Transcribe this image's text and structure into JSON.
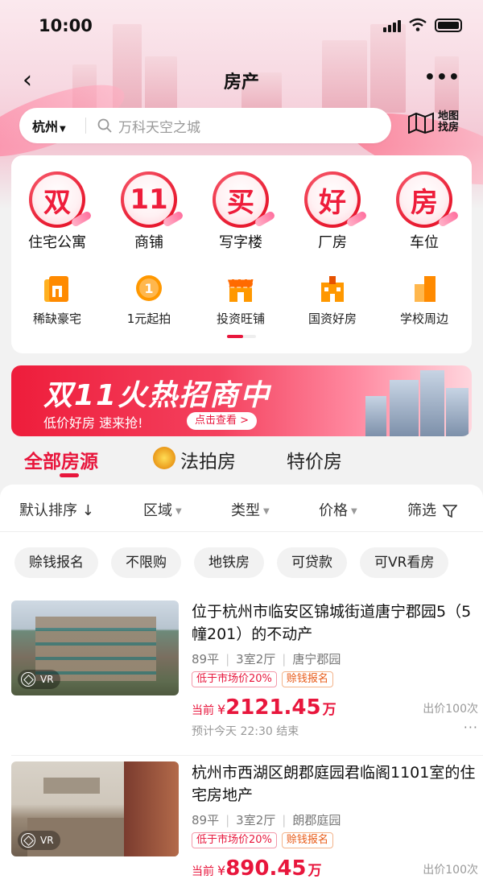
{
  "status": {
    "time": "10:00"
  },
  "nav": {
    "back": "‹",
    "title": "房产",
    "more": "•••"
  },
  "search": {
    "city": "杭州",
    "placeholder": "万科天空之城",
    "map_label": "地图找房"
  },
  "big_categories": [
    {
      "glyph": "双",
      "label": "住宅公寓"
    },
    {
      "glyph": "11",
      "label": "商铺"
    },
    {
      "glyph": "买",
      "label": "写字楼"
    },
    {
      "glyph": "好",
      "label": "厂房"
    },
    {
      "glyph": "房",
      "label": "车位"
    }
  ],
  "small_categories": [
    {
      "label": "稀缺豪宅",
      "icon": "mansion-icon"
    },
    {
      "label": "1元起拍",
      "icon": "coin-icon"
    },
    {
      "label": "投资旺铺",
      "icon": "shop-icon"
    },
    {
      "label": "国资好房",
      "icon": "state-building-icon"
    },
    {
      "label": "学校周边",
      "icon": "school-icon"
    }
  ],
  "promo": {
    "title": "双11火热招商中",
    "subtitle": "低价好房 速来抢!",
    "cta": "点击查看 >"
  },
  "tabs": [
    {
      "label": "全部房源",
      "active": true
    },
    {
      "label": "法拍房",
      "active": false
    },
    {
      "label": "特价房",
      "active": false
    }
  ],
  "sort": {
    "default": "默认排序 ↓",
    "area": "区域",
    "type": "类型",
    "price": "价格",
    "filter": "筛选"
  },
  "chips": [
    "赊钱报名",
    "不限购",
    "地铁房",
    "可贷款",
    "可VR看房"
  ],
  "listings": [
    {
      "title": "位于杭州市临安区锦城街道唐宁郡园5（5幢201）的不动产",
      "area": "89平",
      "layout": "3室2厅",
      "community": "唐宁郡园",
      "tag1": "低于市场价20%",
      "tag2": "赊钱报名",
      "price_label": "当前",
      "currency": "¥",
      "price": "2121.45",
      "unit": "万",
      "bids": "出价100次",
      "end": "预计今天 22:30 结束",
      "vr": "VR"
    },
    {
      "title": "杭州市西湖区朗郡庭园君临阁1101室的住宅房地产",
      "area": "89平",
      "layout": "3室2厅",
      "community": "朗郡庭园",
      "tag1": "低于市场价20%",
      "tag2": "赊钱报名",
      "price_label": "当前",
      "currency": "¥",
      "price": "890.45",
      "unit": "万",
      "bids": "出价100次",
      "vr": "VR"
    }
  ],
  "colors": {
    "accent": "#e8163c",
    "background": "#f2f2f2"
  }
}
